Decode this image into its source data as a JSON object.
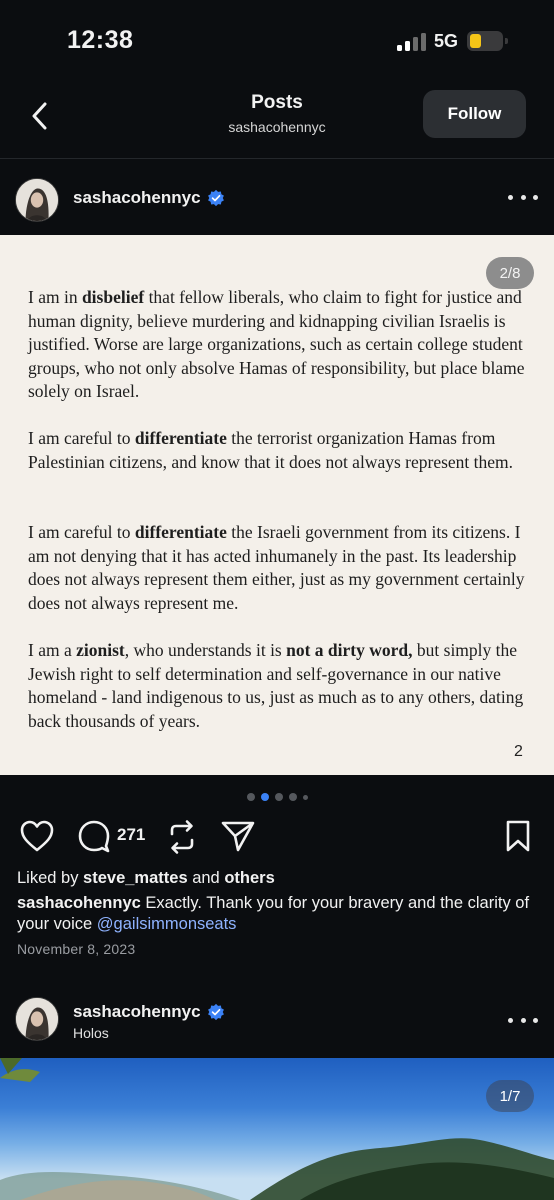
{
  "status": {
    "time": "12:38",
    "network": "5G",
    "battery_color": "#f5c518"
  },
  "header": {
    "title": "Posts",
    "subtitle": "sashacohennyc",
    "follow_label": "Follow",
    "back_icon": "chevron-left-icon"
  },
  "post1": {
    "username": "sashacohennyc",
    "verified": true,
    "slide_counter": "2/8",
    "paragraphs": [
      [
        {
          "t": "I am in "
        },
        {
          "t": "disbelief",
          "b": true
        },
        {
          "t": " that fellow liberals, who claim to fight for justice and human dignity, believe murdering and kidnapping civilian Israelis is justified. Worse are large organizations, such as certain college student groups, who not only absolve Hamas of responsibility, but place blame solely on Israel."
        }
      ],
      [
        {
          "t": "I am careful to "
        },
        {
          "t": "differentiate",
          "b": true
        },
        {
          "t": " the terrorist organization Hamas from Palestinian citizens, and know that it does not always represent them."
        }
      ],
      [
        {
          "t": "I am careful to "
        },
        {
          "t": "differentiate",
          "b": true
        },
        {
          "t": " the Israeli government from its citizens. I am not denying that it has acted inhumanely in the past. Its leadership does not always represent them either, just as my government certainly does not always represent me."
        }
      ],
      [
        {
          "t": "I am a "
        },
        {
          "t": "zionist",
          "b": true
        },
        {
          "t": ", who understands it is "
        },
        {
          "t": "not a dirty word,",
          "b": true
        },
        {
          "t": " but simply the Jewish right to self determination and self-governance in our native homeland - land indigenous to us, just as much as to any others, dating back thousands of years."
        }
      ]
    ],
    "page_number": "2",
    "carousel": {
      "total_dots": 5,
      "active_index": 1
    },
    "comment_count": "271",
    "liked_by_prefix": "Liked by ",
    "liked_by_user": "steve_mattes",
    "liked_by_and": " and ",
    "liked_by_others": "others",
    "caption_user": "sashacohennyc",
    "caption_text": " Exactly. Thank you for your bravery and the clarity of your voice ",
    "caption_mention": "@gailsimmonseats",
    "date": "November 8, 2023"
  },
  "post2": {
    "username": "sashacohennyc",
    "verified": true,
    "location": "Holos",
    "slide_counter": "1/7"
  },
  "colors": {
    "background": "#0b0d10",
    "card": "#f4f0ea",
    "verified": "#3b82f6",
    "mention": "#8fb3ff",
    "active_dot": "#3b82f6"
  }
}
